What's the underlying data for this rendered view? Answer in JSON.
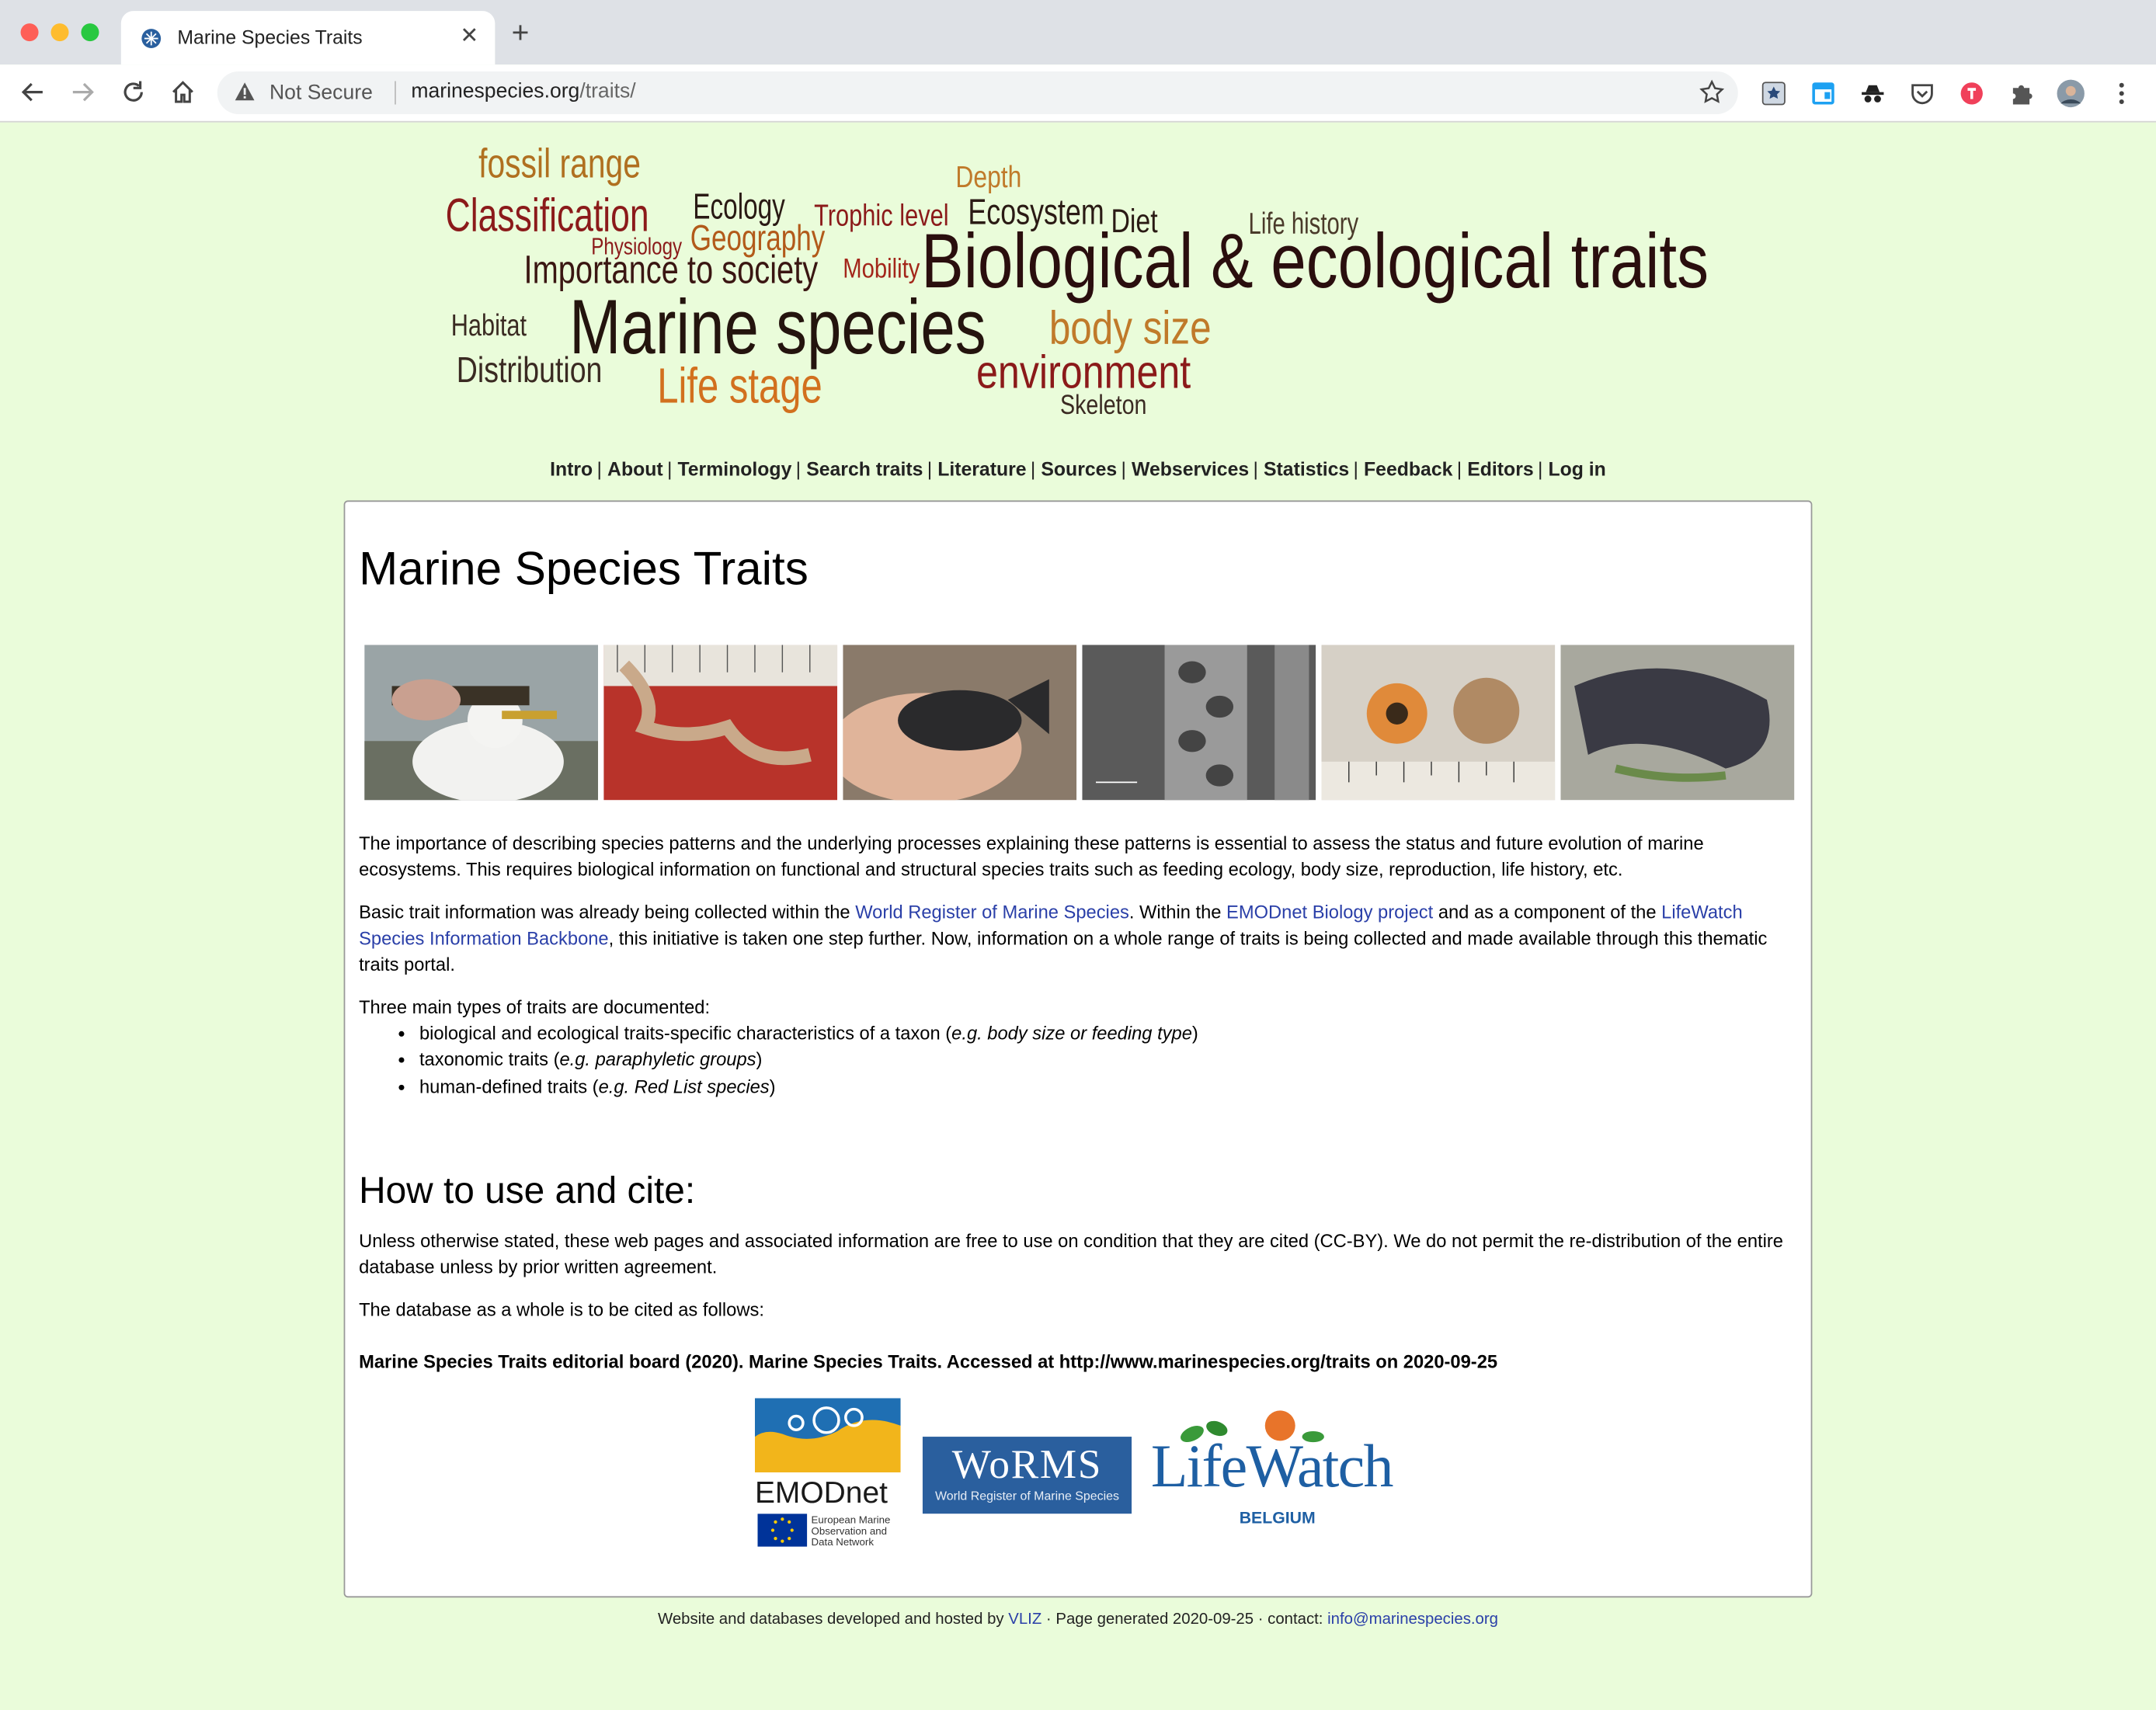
{
  "browser": {
    "tab_title": "Marine Species Traits",
    "security_label": "Not Secure",
    "url_host": "marinespecies.org",
    "url_path": "/traits/"
  },
  "header_cloud": {
    "words": [
      {
        "text": "fossil range",
        "color": "#b07020"
      },
      {
        "text": "Classification",
        "color": "#8b1a1a"
      },
      {
        "text": "Ecology",
        "color": "#2a1a14"
      },
      {
        "text": "Trophic level",
        "color": "#8b1a1a"
      },
      {
        "text": "Depth",
        "color": "#c07a2a"
      },
      {
        "text": "Ecosystem",
        "color": "#2a1a14"
      },
      {
        "text": "Diet",
        "color": "#2a1a14"
      },
      {
        "text": "Life history",
        "color": "#4a3a2a"
      },
      {
        "text": "Physiology",
        "color": "#8b1a1a"
      },
      {
        "text": "Geography",
        "color": "#b25a1a"
      },
      {
        "text": "Importance to society",
        "color": "#3a1612"
      },
      {
        "text": "Mobility",
        "color": "#a3261a"
      },
      {
        "text": "Biological & ecological traits",
        "color": "#2a0e0e"
      },
      {
        "text": "Habitat",
        "color": "#3a2a22"
      },
      {
        "text": "Marine species",
        "color": "#24140e"
      },
      {
        "text": "body size",
        "color": "#c07a2a"
      },
      {
        "text": "Distribution",
        "color": "#3a2a22"
      },
      {
        "text": "Life stage",
        "color": "#d2701e"
      },
      {
        "text": "environment",
        "color": "#8b1a1a"
      },
      {
        "text": "Skeleton",
        "color": "#3a2a22"
      }
    ]
  },
  "nav": {
    "items": [
      "Intro",
      "About",
      "Terminology",
      "Search traits",
      "Literature",
      "Sources",
      "Webservices",
      "Statistics",
      "Feedback",
      "Editors",
      "Log in"
    ]
  },
  "main": {
    "title": "Marine Species Traits",
    "intro_paragraph": "The importance of describing species patterns and the underlying processes explaining these patterns is essential to assess the status and future evolution of marine ecosystems. This requires biological information on functional and structural species traits such as feeding ecology, body size, reproduction, life history, etc.",
    "basic_p": {
      "t1": "Basic trait information was already being collected within the ",
      "link1": "World Register of Marine Species",
      "t2": ". Within the ",
      "link2": "EMODnet Biology project",
      "t3": " and as a component of the ",
      "link3": "LifeWatch Species Information Backbone",
      "t4": ", this initiative is taken one step further. Now, information on a whole range of traits is being collected and made available through this thematic traits portal."
    },
    "types_intro": "Three main types of traits are documented:",
    "trait_types": [
      {
        "text": "biological and ecological traits-specific characteristics of a taxon (",
        "example": "e.g. body size or feeding type",
        "close": ")"
      },
      {
        "text": "taxonomic traits (",
        "example": "e.g. paraphyletic groups",
        "close": ")"
      },
      {
        "text": "human-defined traits (",
        "example": "e.g. Red List species",
        "close": ")"
      }
    ],
    "cite_heading": "How to use and cite:",
    "cite_paragraph": "Unless otherwise stated, these web pages and associated information are free to use on condition that they are cited (CC-BY). We do not permit the re-distribution of the entire database unless by prior written agreement.",
    "cite_intro": "The database as a whole is to be cited as follows:",
    "citation": "Marine Species Traits editorial board (2020). Marine Species Traits. Accessed at http://www.marinespecies.org/traits on 2020-09-25",
    "logos": {
      "emodnet_name": "EMODnet",
      "emodnet_sub1": "European Marine",
      "emodnet_sub2": "Observation and",
      "emodnet_sub3": "Data Network",
      "worms_name": "WoRMS",
      "worms_sub": "World Register of Marine Species",
      "lifewatch_name": "LifeWatch",
      "lifewatch_sub": "BELGIUM"
    }
  },
  "footer": {
    "t1": "Website and databases developed and hosted by ",
    "vliz": "VLIZ",
    "t2": " · Page generated 2020-09-25 · contact: ",
    "email": "info@marinespecies.org"
  },
  "colors": {
    "page_bg": "#eafcda",
    "link": "#2a3fa8",
    "worms_blue": "#2a5f9e",
    "emodnet_blue": "#1f6fb3",
    "emodnet_yellow": "#f2b51b",
    "lifewatch_blue": "#1e5fa3",
    "lifewatch_orange": "#e8742a"
  }
}
